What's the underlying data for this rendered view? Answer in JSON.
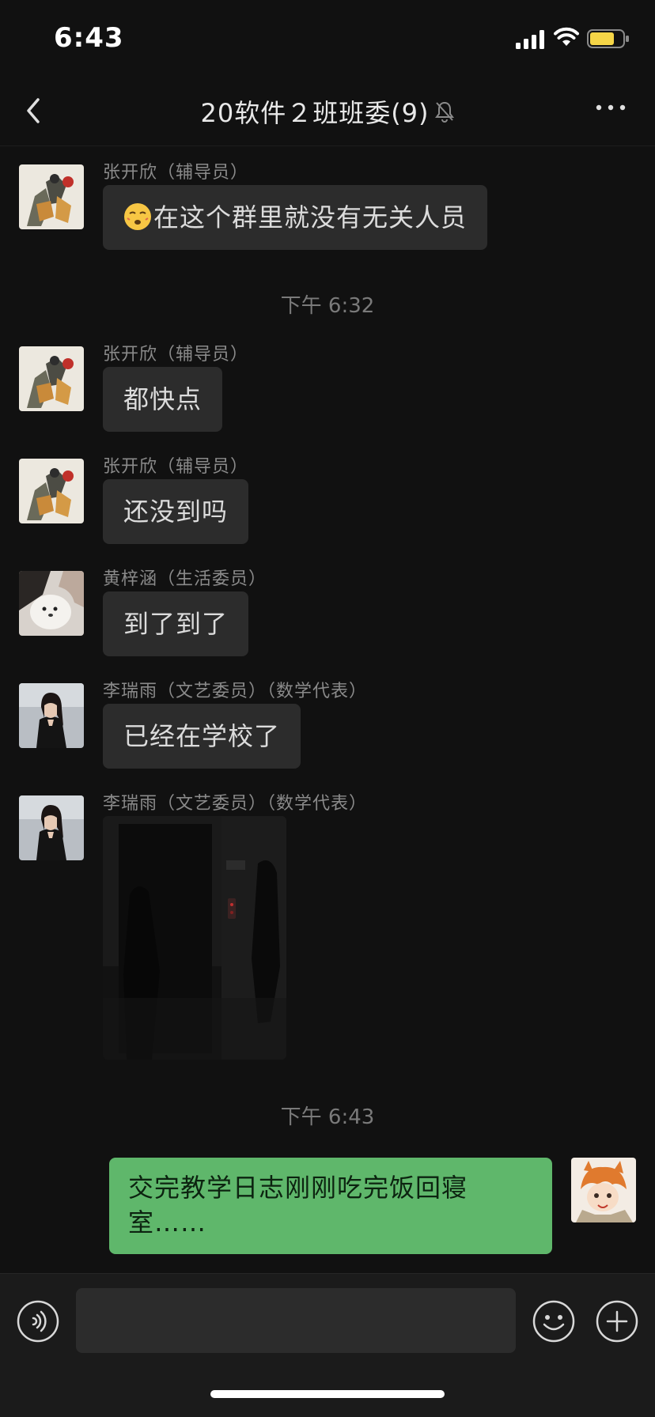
{
  "status_bar": {
    "time": "6:43"
  },
  "header": {
    "title": "20软件２班班委(9)"
  },
  "messages": [
    {
      "sender": "张开欣（辅导员）",
      "text": "在这个群里就没有无关人员"
    },
    {
      "time_separator": "下午 6:32"
    },
    {
      "sender": "张开欣（辅导员）",
      "text": "都快点"
    },
    {
      "sender": "张开欣（辅导员）",
      "text": "还没到吗"
    },
    {
      "sender": "黄梓涵（生活委员）",
      "text": "到了到了"
    },
    {
      "sender": "李瑞雨（文艺委员）（数学代表）",
      "text": "已经在学校了"
    },
    {
      "sender": "李瑞雨（文艺委员）（数学代表）",
      "type": "image"
    },
    {
      "time_separator": "下午 6:43"
    },
    {
      "sender": "me",
      "text": "交完教学日志刚刚吃完饭回寝室……"
    }
  ],
  "input": {
    "placeholder": ""
  },
  "colors": {
    "background": "#111111",
    "bubble_incoming": "#2c2c2c",
    "bubble_outgoing": "#5fb76b",
    "sender_text": "#8a8a8a",
    "time_separator_text": "#7a7a7a"
  }
}
